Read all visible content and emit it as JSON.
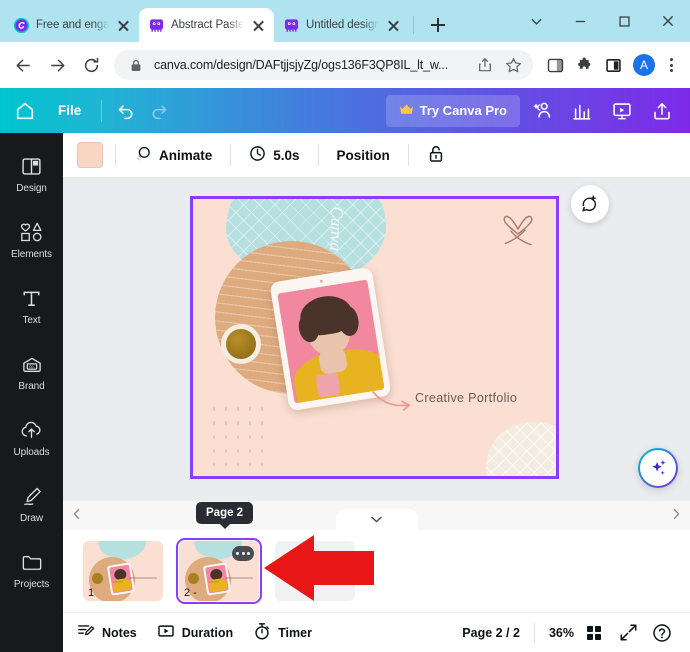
{
  "browser": {
    "tabs": [
      {
        "title": "Free and engag",
        "favicon": "canva-circle-icon",
        "active": false
      },
      {
        "title": "Abstract Pastel",
        "favicon": "canva-icon",
        "active": true
      },
      {
        "title": "Untitled design",
        "favicon": "canva-icon",
        "active": false
      }
    ],
    "new_tab_label": "+",
    "window_controls": {
      "chevron": "v",
      "minimize": "—",
      "maximize": "□",
      "close": "✕"
    },
    "nav": {
      "back": "back-arrow-icon",
      "forward": "forward-arrow-icon",
      "reload": "reload-icon"
    },
    "omnibox": {
      "url": "canva.com/design/DAFtjjsjyZg/ogs136F3QP8IL_lt_w...",
      "lock": "lock-icon",
      "share": "share-icon",
      "bookmark": "star-icon"
    },
    "toolbar_icons": [
      "sidepanel-add-icon",
      "extensions-puzzle-icon",
      "reading-list-icon"
    ],
    "avatar_letter": "A"
  },
  "canva_header": {
    "home": "home-icon",
    "file_label": "File",
    "undo": "undo-icon",
    "redo": "redo-icon",
    "try_pro_label": "Try Canva Pro",
    "crown": "crown-icon",
    "icons": [
      "share-people-icon",
      "insights-chart-icon",
      "present-icon",
      "upload-export-icon"
    ]
  },
  "sidebar": {
    "items": [
      {
        "label": "Design",
        "icon": "layout-design-icon"
      },
      {
        "label": "Elements",
        "icon": "shapes-elements-icon"
      },
      {
        "label": "Text",
        "icon": "text-t-icon"
      },
      {
        "label": "Brand",
        "icon": "brand-kit-icon"
      },
      {
        "label": "Uploads",
        "icon": "cloud-upload-icon"
      },
      {
        "label": "Draw",
        "icon": "pen-draw-icon"
      },
      {
        "label": "Projects",
        "icon": "folder-projects-icon"
      }
    ]
  },
  "edit_toolbar": {
    "color_swatch": "#f9d6c4",
    "animate_label": "Animate",
    "animate_icon": "animate-icon",
    "duration_value": "5.0s",
    "clock_icon": "clock-icon",
    "position_label": "Position",
    "lock_icon": "unlocked-padlock-icon"
  },
  "canvas": {
    "page_text": "Creative Portfolio",
    "watermark_script": "Canva",
    "selection_color": "#8b3dff",
    "background_color": "#fadfd2",
    "comment_fab": "add-comment-icon",
    "magic_fab": "magic-sparkles-icon"
  },
  "page_strip": {
    "scroll_left": "chevron-left-icon",
    "scroll_right": "chevron-right-icon",
    "collapse": "chevron-down-icon",
    "tooltip": "Page 2",
    "thumbnails": [
      {
        "number": "1",
        "selected": false,
        "blank": false
      },
      {
        "number": "2 -",
        "selected": true,
        "blank": false
      },
      {
        "number": "",
        "selected": false,
        "blank": true
      }
    ]
  },
  "bottom_bar": {
    "notes_label": "Notes",
    "notes_icon": "notes-icon",
    "duration_label": "Duration",
    "duration_icon": "duration-play-icon",
    "timer_label": "Timer",
    "timer_icon": "timer-stopwatch-icon",
    "page_indicator": "Page 2 / 2",
    "zoom_level": "36%",
    "grid_icon": "grid-view-icon",
    "fullscreen_icon": "expand-fullscreen-icon",
    "help_icon": "help-question-icon"
  },
  "annotation": {
    "arrow_color": "#e81616",
    "arrow_direction": "left"
  }
}
